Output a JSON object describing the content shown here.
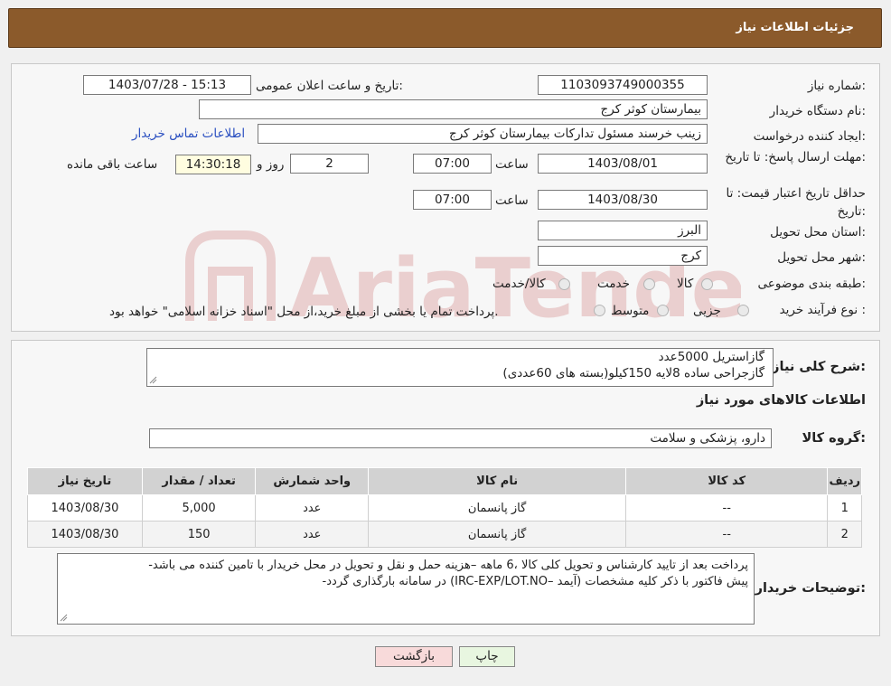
{
  "header": {
    "title": "جزئیات اطلاعات نیاز"
  },
  "need_number": {
    "label": "شماره نیاز:",
    "value": "1103093749000355"
  },
  "announce": {
    "label": "تاریخ و ساعت اعلان عمومی:",
    "value": "1403/07/28 - 15:13"
  },
  "buyer_org": {
    "label": "نام دستگاه خریدار:",
    "value": "بیمارستان کوثر کرج"
  },
  "requester": {
    "label": "ایجاد کننده درخواست:",
    "value": "زینب خرسند مسئول تدارکات بیمارستان کوثر کرج",
    "contact_link": "اطلاعات تماس خریدار"
  },
  "deadline": {
    "label": "مهلت ارسال پاسخ: تا تاریخ:",
    "date": "1403/08/01",
    "time_label": "ساعت",
    "time": "07:00",
    "days": "2",
    "days_label": "روز و",
    "remaining": "14:30:18",
    "remaining_label": "ساعت باقی مانده"
  },
  "validity": {
    "label": "حداقل تاریخ اعتبار قیمت: تا تاریخ:",
    "date": "1403/08/30",
    "time_label": "ساعت",
    "time": "07:00"
  },
  "province": {
    "label": "استان محل تحویل:",
    "value": "البرز"
  },
  "city": {
    "label": "شهر محل تحویل:",
    "value": "کرج"
  },
  "category": {
    "label": "طبقه بندی موضوعی:",
    "options": [
      "کالا",
      "خدمت",
      "کالا/خدمت"
    ]
  },
  "process": {
    "label": "نوع فرآیند خرید :",
    "options": [
      "جزیی",
      "متوسط"
    ],
    "note": "پرداخت تمام یا بخشی از مبلغ خرید،از محل \"اسناد خزانه اسلامی\" خواهد بود."
  },
  "summary": {
    "label": "شرح کلی نیاز:",
    "line1": "گازاستریل   5000عدد",
    "line2": "گازجراحی ساده 8لایه    150کیلو(بسته های 60عددی)"
  },
  "goods_info": {
    "title": "اطلاعات کالاهای مورد نیاز"
  },
  "goods_group": {
    "label": "گروه کالا:",
    "value": "دارو، پزشکی و سلامت"
  },
  "table": {
    "headers": [
      "ردیف",
      "کد کالا",
      "نام کالا",
      "واحد شمارش",
      "تعداد / مقدار",
      "تاریخ نیاز"
    ],
    "rows": [
      [
        "1",
        "--",
        "گاز پانسمان",
        "عدد",
        "5,000",
        "1403/08/30"
      ],
      [
        "2",
        "--",
        "گاز پانسمان",
        "عدد",
        "150",
        "1403/08/30"
      ]
    ]
  },
  "buyer_notes": {
    "label": "توضیحات خریدار:",
    "line1": "پرداخت بعد از تایید کارشناس و تحویل کلی کالا ،6 ماهه –هزینه حمل و نقل و تحویل در محل خریدار با تامین کننده می باشد-",
    "line2": "پیش فاکتور با ذکر کلیه مشخصات (آیمد –IRC-EXP/LOT.NO) در سامانه بارگذاری گردد-"
  },
  "buttons": {
    "print": "چاپ",
    "back": "بازگشت"
  },
  "watermark": {
    "text": "AriaTender.net"
  },
  "colors": {
    "header_bg": "#8b5a2b",
    "link": "#2a4fc0",
    "print_btn": "#e8f6e0",
    "back_btn": "#f8dada"
  }
}
